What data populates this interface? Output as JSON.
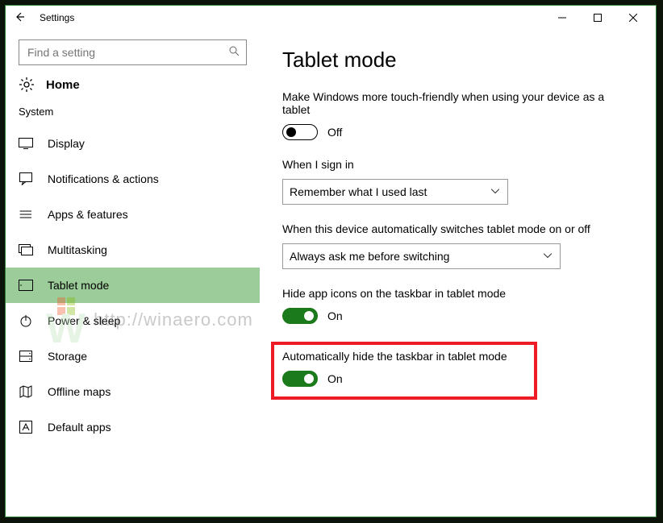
{
  "titlebar": {
    "title": "Settings"
  },
  "search": {
    "placeholder": "Find a setting"
  },
  "home": {
    "label": "Home"
  },
  "section_label": "System",
  "nav": {
    "items": [
      {
        "label": "Display"
      },
      {
        "label": "Notifications & actions"
      },
      {
        "label": "Apps & features"
      },
      {
        "label": "Multitasking"
      },
      {
        "label": "Tablet mode"
      },
      {
        "label": "Power & sleep"
      },
      {
        "label": "Storage"
      },
      {
        "label": "Offline maps"
      },
      {
        "label": "Default apps"
      }
    ]
  },
  "page": {
    "title": "Tablet mode",
    "touch_friendly": {
      "label": "Make Windows more touch-friendly when using your device as a tablet",
      "state_text": "Off",
      "on": false
    },
    "signin": {
      "label": "When I sign in",
      "value": "Remember what I used last"
    },
    "switch_mode": {
      "label": "When this device automatically switches tablet mode on or off",
      "value": "Always ask me before switching"
    },
    "hide_icons": {
      "label": "Hide app icons on the taskbar in tablet mode",
      "state_text": "On",
      "on": true
    },
    "auto_hide_taskbar": {
      "label": "Automatically hide the taskbar in tablet mode",
      "state_text": "On",
      "on": true
    }
  },
  "watermark": {
    "text": "http://winaero.com"
  }
}
